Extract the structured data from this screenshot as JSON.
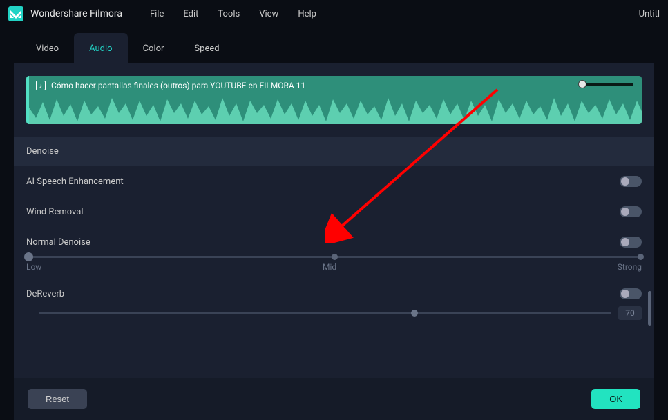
{
  "app": {
    "name": "Wondershare Filmora",
    "doc_title": "Untitl"
  },
  "menu": {
    "file": "File",
    "edit": "Edit",
    "tools": "Tools",
    "view": "View",
    "help": "Help"
  },
  "tabs": {
    "video": "Video",
    "audio": "Audio",
    "color": "Color",
    "speed": "Speed",
    "active": "Audio"
  },
  "clip": {
    "title": "Cómo hacer pantallas finales (outros) para YOUTUBE en FILMORA 11"
  },
  "denoise": {
    "section_label": "Denoise",
    "ai_speech": {
      "label": "AI Speech Enhancement",
      "on": false
    },
    "wind_removal": {
      "label": "Wind Removal",
      "on": false
    },
    "normal": {
      "label": "Normal Denoise",
      "on": false,
      "slider_labels": {
        "low": "Low",
        "mid": "Mid",
        "strong": "Strong"
      },
      "value": 0
    },
    "dereverb": {
      "label": "DeReverb",
      "on": false,
      "value": "70"
    }
  },
  "buttons": {
    "reset": "Reset",
    "ok": "OK"
  }
}
